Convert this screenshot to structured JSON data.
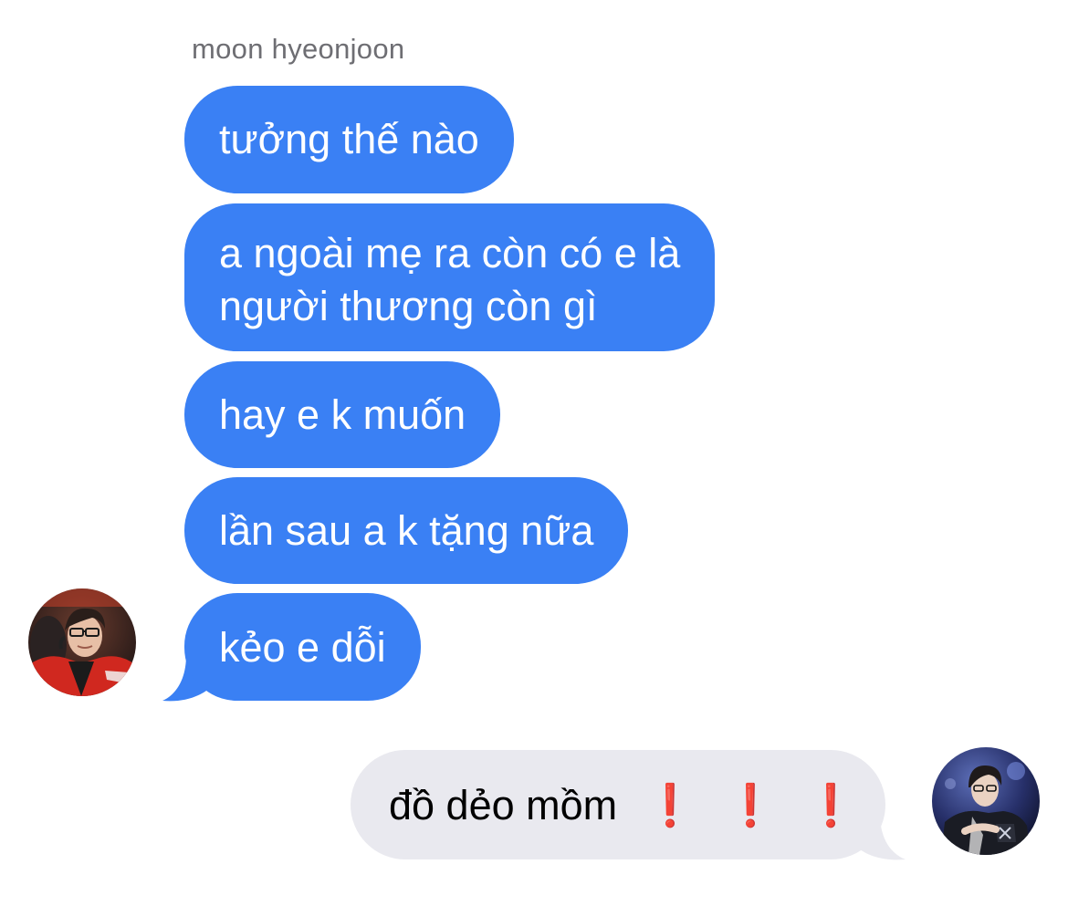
{
  "conversation": {
    "sender_name": "moon hyeonjoon",
    "incoming_messages": [
      {
        "text": "tưởng thế nào"
      },
      {
        "text_line1": "a ngoài mẹ ra còn có e là",
        "text_line2": "người thương còn gì"
      },
      {
        "text": "hay e k muốn"
      },
      {
        "text": "lần sau a k tặng nữa"
      },
      {
        "text": "kẻo e dỗi"
      }
    ],
    "outgoing_message": {
      "text": "đồ dẻo mồm",
      "emoji": [
        "❗",
        "❗",
        "❗"
      ]
    }
  },
  "colors": {
    "incoming_bubble": "#3a80f4",
    "incoming_text": "#ffffff",
    "outgoing_bubble": "#e9e9ef",
    "outgoing_text": "#000000",
    "exclamation": "#e0141e",
    "sender_name": "#6e6e73"
  },
  "avatars": {
    "left": "contact-avatar-red-jersey",
    "right": "user-avatar-dark-jersey"
  }
}
